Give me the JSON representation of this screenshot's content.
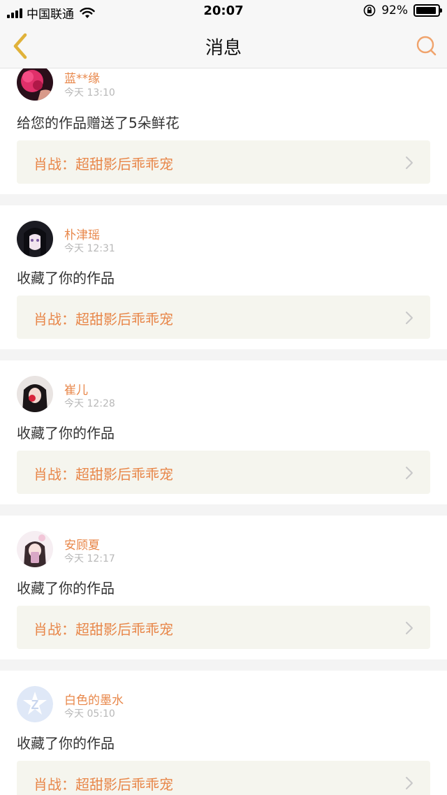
{
  "status_bar": {
    "carrier": "中国联通",
    "time": "20:07",
    "battery": "92%",
    "battery_level": 0.92
  },
  "nav": {
    "title": "消息"
  },
  "colors": {
    "accent": "#e8874a",
    "back_arrow": "#e0b23a",
    "link_background": "#f5f5ee"
  },
  "notifications": [
    {
      "avatar_icon": "avatar-pink-flower-icon",
      "username": "蓝**缘",
      "time": "今天 13:10",
      "message": "给您的作品赠送了5朵鲜花",
      "work": "肖战：超甜影后乖乖宠"
    },
    {
      "avatar_icon": "avatar-anime-girl-icon",
      "username": "朴津瑶",
      "time": "今天 12:31",
      "message": "收藏了你的作品",
      "work": "肖战：超甜影后乖乖宠"
    },
    {
      "avatar_icon": "avatar-girl-with-rose-icon",
      "username": "崔儿",
      "time": "今天 12:28",
      "message": "收藏了你的作品",
      "work": "肖战：超甜影后乖乖宠"
    },
    {
      "avatar_icon": "avatar-girl-selfie-icon",
      "username": "安顾夏",
      "time": "今天 12:17",
      "message": "收藏了你的作品",
      "work": "肖战：超甜影后乖乖宠"
    },
    {
      "avatar_icon": "avatar-default-qq-icon",
      "username": "白色的墨水",
      "time": "今天 05:10",
      "message": "收藏了你的作品",
      "work": "肖战：超甜影后乖乖宠"
    }
  ]
}
